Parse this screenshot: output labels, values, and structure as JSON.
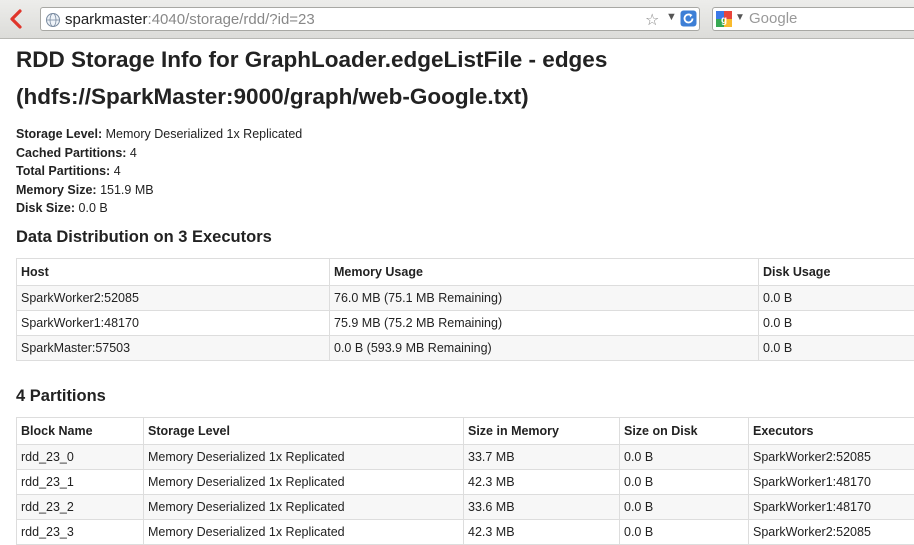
{
  "browser": {
    "url_host": "sparkmaster",
    "url_path": ":4040/storage/rdd/?id=23",
    "search_placeholder": "Google"
  },
  "page": {
    "title": "RDD Storage Info for GraphLoader.edgeListFile - edges (hdfs://SparkMaster:9000/graph/web-Google.txt)",
    "info": [
      {
        "label": "Storage Level:",
        "value": "Memory Deserialized 1x Replicated"
      },
      {
        "label": "Cached Partitions:",
        "value": "4"
      },
      {
        "label": "Total Partitions:",
        "value": "4"
      },
      {
        "label": "Memory Size:",
        "value": "151.9 MB"
      },
      {
        "label": "Disk Size:",
        "value": "0.0 B"
      }
    ]
  },
  "distribution": {
    "heading": "Data Distribution on 3 Executors",
    "columns": [
      "Host",
      "Memory Usage",
      "Disk Usage"
    ],
    "rows": [
      [
        "SparkWorker2:52085",
        "76.0 MB (75.1 MB Remaining)",
        "0.0 B"
      ],
      [
        "SparkWorker1:48170",
        "75.9 MB (75.2 MB Remaining)",
        "0.0 B"
      ],
      [
        "SparkMaster:57503",
        "0.0 B (593.9 MB Remaining)",
        "0.0 B"
      ]
    ]
  },
  "partitions": {
    "heading": "4 Partitions",
    "columns": [
      "Block Name",
      "Storage Level",
      "Size in Memory",
      "Size on Disk",
      "Executors"
    ],
    "rows": [
      [
        "rdd_23_0",
        "Memory Deserialized 1x Replicated",
        "33.7 MB",
        "0.0 B",
        "SparkWorker2:52085"
      ],
      [
        "rdd_23_1",
        "Memory Deserialized 1x Replicated",
        "42.3 MB",
        "0.0 B",
        "SparkWorker1:48170"
      ],
      [
        "rdd_23_2",
        "Memory Deserialized 1x Replicated",
        "33.6 MB",
        "0.0 B",
        "SparkWorker1:48170"
      ],
      [
        "rdd_23_3",
        "Memory Deserialized 1x Replicated",
        "42.3 MB",
        "0.0 B",
        "SparkWorker2:52085"
      ]
    ]
  }
}
